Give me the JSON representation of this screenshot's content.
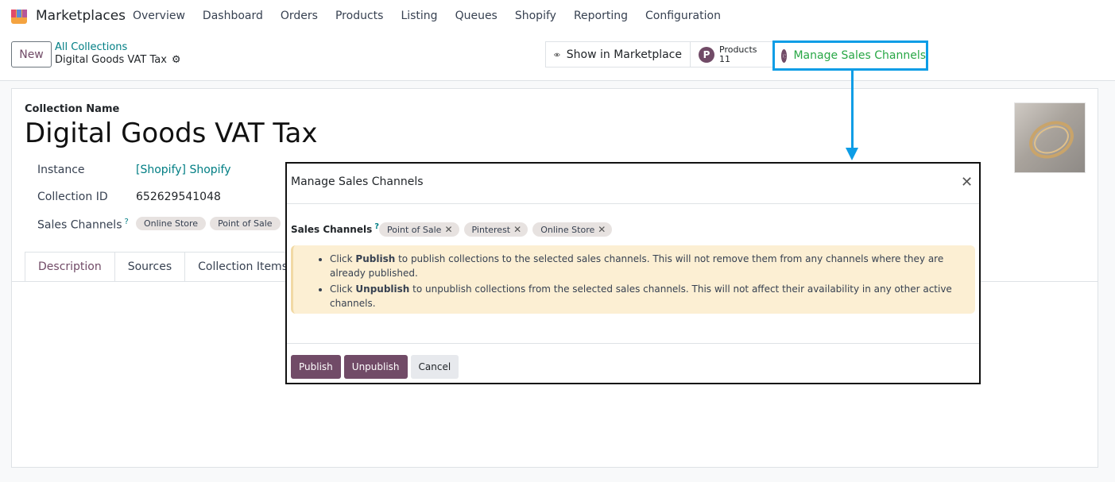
{
  "app": {
    "name": "Marketplaces",
    "menu": [
      "Overview",
      "Dashboard",
      "Orders",
      "Products",
      "Listing",
      "Queues",
      "Shopify",
      "Reporting",
      "Configuration"
    ]
  },
  "control": {
    "new_label": "New",
    "breadcrumb_parent": "All Collections",
    "breadcrumb_current": "Digital Goods VAT Tax",
    "show_marketplace": "Show in Marketplace",
    "products_label": "Products",
    "products_count": "11",
    "manage_channels": "Manage Sales Channels"
  },
  "form": {
    "name_label": "Collection Name",
    "title": "Digital Goods VAT Tax",
    "instance_label": "Instance",
    "instance_value": "[Shopify] Shopify",
    "collection_id_label": "Collection ID",
    "collection_id_value": "652629541048",
    "sales_channels_label": "Sales Channels",
    "help_mark": "?",
    "sales_channels": [
      "Online Store",
      "Point of Sale"
    ],
    "tabs": [
      "Description",
      "Sources",
      "Collection Items"
    ]
  },
  "dialog": {
    "title": "Manage Sales Channels",
    "field_label": "Sales Channels",
    "help_mark": "?",
    "tags": [
      "Point of Sale",
      "Pinterest",
      "Online Store"
    ],
    "notes": [
      {
        "prefix": "Click ",
        "bold": "Publish",
        "rest": " to publish collections to the selected sales channels. This will not remove them from any channels where they are already published."
      },
      {
        "prefix": "Click ",
        "bold": "Unpublish",
        "rest": " to unpublish collections from the selected sales channels. This will not affect their availability in any other active channels."
      }
    ],
    "publish_label": "Publish",
    "unpublish_label": "Unpublish",
    "cancel_label": "Cancel"
  },
  "colors": {
    "brand": "#714B67",
    "highlight": "#0d9de6",
    "link": "#017e84",
    "success": "#28a745",
    "alert_bg": "#fcefd3"
  },
  "icons": [
    "app-logo-icon",
    "gear-icon",
    "eye-icon",
    "products-icon",
    "globe-icon",
    "close-icon",
    "remove-tag-icon"
  ]
}
